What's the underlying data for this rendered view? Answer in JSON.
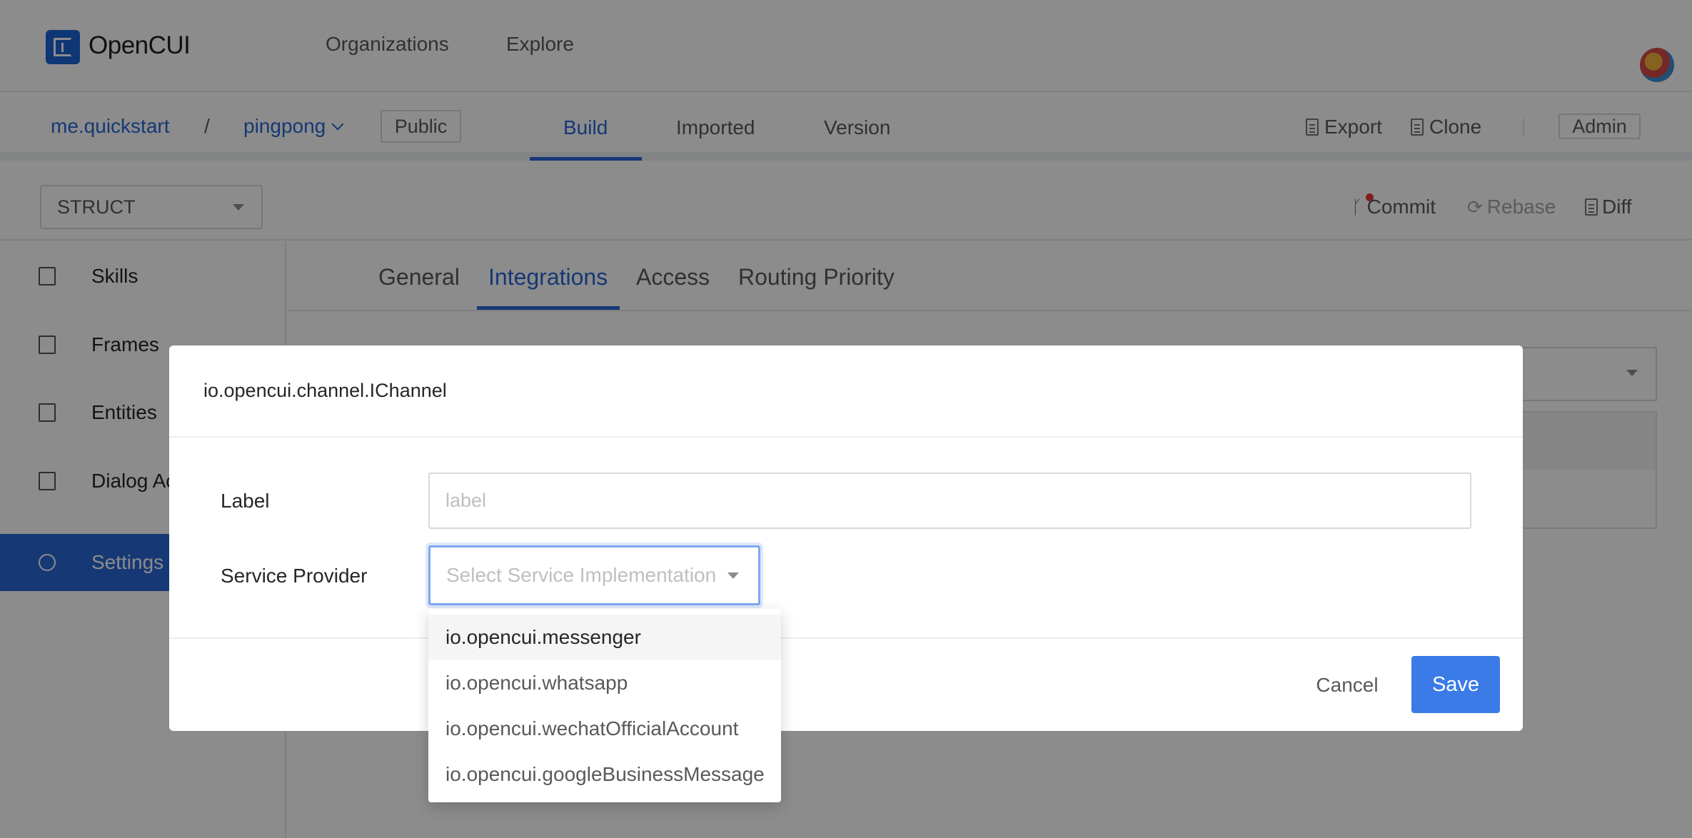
{
  "topnav": {
    "brand": "OpenCUI",
    "links": [
      "Organizations",
      "Explore"
    ]
  },
  "project": {
    "org": "me.quickstart",
    "separator": "/",
    "name": "pingpong",
    "visibility": "Public",
    "tabs": [
      "Build",
      "Imported",
      "Version"
    ],
    "active_tab": "Build",
    "actions": {
      "export": "Export",
      "clone": "Clone",
      "admin": "Admin"
    }
  },
  "toolbar": {
    "struct_select": "STRUCT",
    "commit": "Commit",
    "rebase": "Rebase",
    "diff": "Diff"
  },
  "sidebar": {
    "items": [
      {
        "label": "Skills",
        "icon": "file-icon"
      },
      {
        "label": "Frames",
        "icon": "frames-icon"
      },
      {
        "label": "Entities",
        "icon": "entities-icon"
      },
      {
        "label": "Dialog Ac",
        "icon": "dialog-icon"
      },
      {
        "label": "Settings",
        "icon": "gear-icon"
      }
    ],
    "active": "Settings"
  },
  "settings_tabs": [
    "General",
    "Integrations",
    "Access",
    "Routing Priority"
  ],
  "settings_active_tab": "Integrations",
  "modal": {
    "title": "io.opencui.channel.IChannel",
    "label_field": {
      "label": "Label",
      "placeholder": "label",
      "value": ""
    },
    "provider_field": {
      "label": "Service Provider",
      "placeholder": "Select Service Implementation"
    },
    "cancel": "Cancel",
    "save": "Save"
  },
  "dropdown": {
    "options": [
      "io.opencui.messenger",
      "io.opencui.whatsapp",
      "io.opencui.wechatOfficialAccount",
      "io.opencui.googleBusinessMessage"
    ],
    "highlighted_index": 0
  },
  "colors": {
    "accent": "#2867d6",
    "primary_button": "#3a7be8",
    "overlay": "rgba(0,0,0,0.45)"
  }
}
